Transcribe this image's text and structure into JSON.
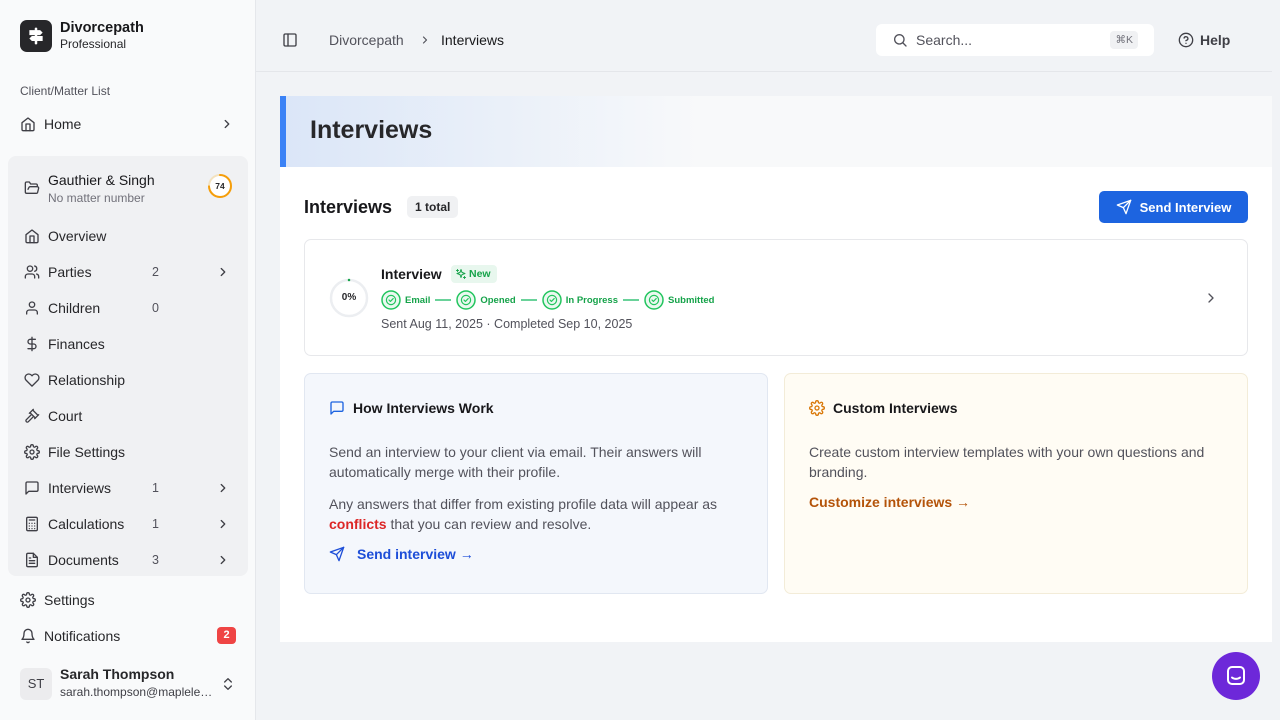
{
  "brand": {
    "name": "Divorcepath",
    "plan": "Professional"
  },
  "sidebar": {
    "section_label": "Client/Matter List",
    "home_label": "Home",
    "matter": {
      "name": "Gauthier & Singh",
      "sub": "No matter number",
      "progress": "74",
      "progress_fraction": 0.74
    },
    "items": [
      {
        "label": "Overview",
        "count": ""
      },
      {
        "label": "Parties",
        "count": "2"
      },
      {
        "label": "Children",
        "count": "0"
      },
      {
        "label": "Finances",
        "count": ""
      },
      {
        "label": "Relationship",
        "count": ""
      },
      {
        "label": "Court",
        "count": ""
      },
      {
        "label": "File Settings",
        "count": ""
      },
      {
        "label": "Interviews",
        "count": "1"
      },
      {
        "label": "Calculations",
        "count": "1"
      },
      {
        "label": "Documents",
        "count": "3"
      }
    ],
    "settings_label": "Settings",
    "notifications_label": "Notifications",
    "notifications_count": "2",
    "user": {
      "initials": "ST",
      "name": "Sarah Thompson",
      "email": "sarah.thompson@maplelegal.com"
    }
  },
  "topbar": {
    "breadcrumb": [
      "Divorcepath",
      "Interviews"
    ],
    "search_placeholder": "Search...",
    "search_shortcut": "⌘K",
    "help_label": "Help"
  },
  "page": {
    "title": "Interviews"
  },
  "interviews": {
    "heading": "Interviews",
    "total": "1 total",
    "send_button": "Send Interview",
    "items": [
      {
        "percent": "0%",
        "percent_value": 0,
        "title": "Interview",
        "badge": "New",
        "steps": [
          "Email",
          "Opened",
          "In Progress",
          "Submitted"
        ],
        "dates": "Sent Aug 11, 2025 · Completed Sep 10, 2025"
      }
    ]
  },
  "how_it_works": {
    "title": "How Interviews Work",
    "text1": "Send an interview to your client via email. Their answers will automatically merge with their profile.",
    "text2_before": "Any answers that differ from existing profile data will appear as",
    "text2_highlight": "conflicts",
    "text2_after": "that you can review and resolve.",
    "link": "Send interview →"
  },
  "custom": {
    "title": "Custom Interviews",
    "text": "Create custom interview templates with your own questions and branding.",
    "link": "Customize interviews →"
  },
  "colors": {
    "primary": "#1d64e0",
    "accent_border": "#3b82f6",
    "success": "#16a34a",
    "danger": "#dc2626",
    "amber": "#b45309",
    "progress_ring": "#f59e0b",
    "chat": "#6d28d9"
  },
  "icons": {
    "brand": "signpost-icon",
    "home": "home-icon",
    "matter": "folder-open-icon",
    "overview": "home-icon",
    "parties": "users-icon",
    "children": "user-icon",
    "finances": "dollar-icon",
    "relationship": "heart-icon",
    "court": "gavel-icon",
    "file_settings": "gear-icon",
    "interviews": "message-square-icon",
    "calculations": "calculator-icon",
    "documents": "file-text-icon",
    "settings": "gear-icon",
    "notifications": "bell-icon",
    "search": "search-icon",
    "help": "help-circle-icon",
    "send": "send-icon",
    "chat": "chat-icon"
  }
}
